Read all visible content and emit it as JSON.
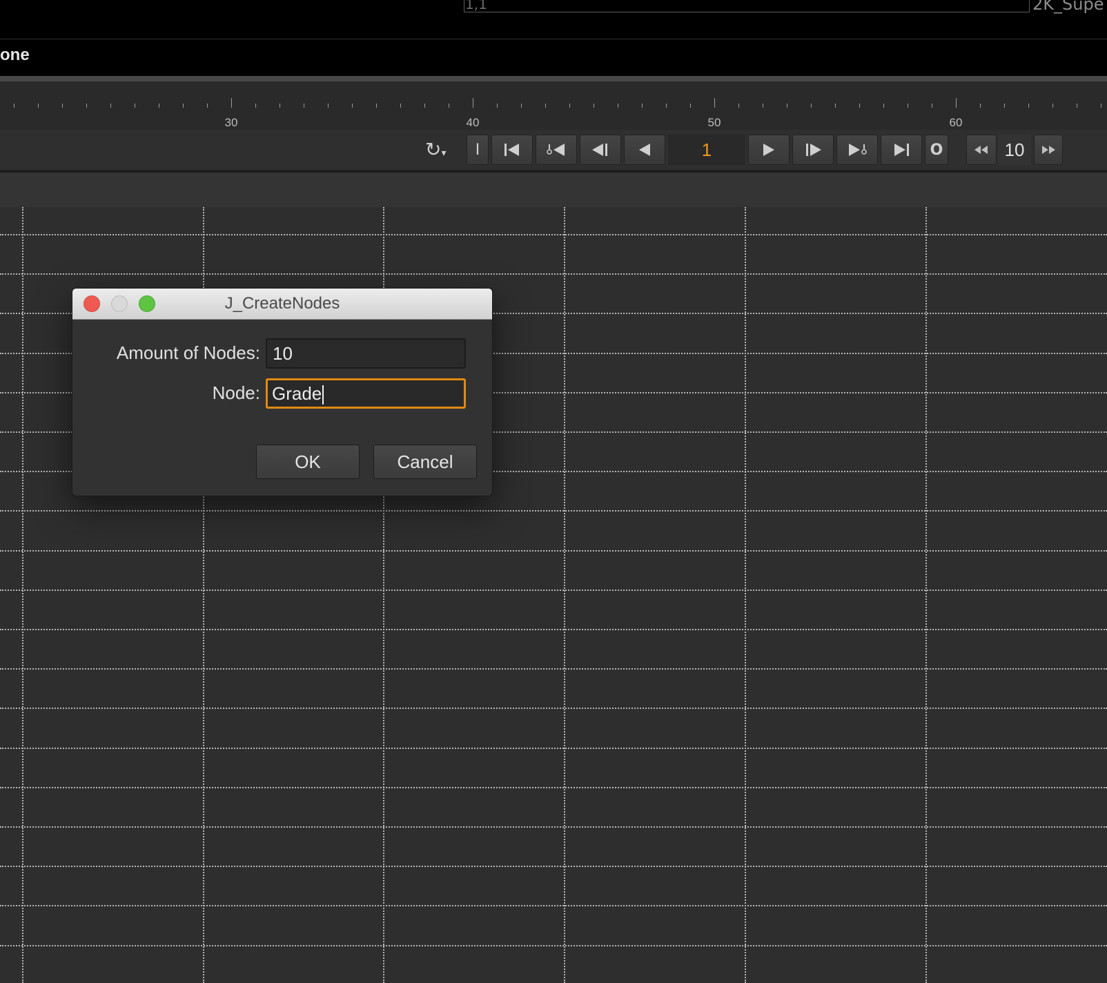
{
  "viewer": {
    "coord_label": "1,1",
    "format_label": "2K_Supe"
  },
  "status": {
    "text": "one"
  },
  "timeline": {
    "labels": [
      "30",
      "40",
      "50",
      "60"
    ]
  },
  "transport": {
    "loop_icon": "loop-mode-icon",
    "in_button": "I",
    "out_button": "O",
    "current_frame": "1",
    "step_value": "10",
    "icons": [
      "first-frame-icon",
      "prev-keyframe-icon",
      "prev-frame-icon",
      "play-backward-icon",
      "play-forward-icon",
      "next-frame-icon",
      "next-keyframe-icon",
      "last-frame-icon",
      "step-back-icon",
      "step-forward-icon"
    ],
    "accent_color": "#f29a1e"
  },
  "dialog": {
    "title": "J_CreateNodes",
    "fields": [
      {
        "label": "Amount of Nodes:",
        "value": "10"
      },
      {
        "label": "Node:",
        "value": "Grade"
      }
    ],
    "ok_label": "OK",
    "cancel_label": "Cancel",
    "focus_color": "#e08a12",
    "traffic_lights": {
      "close": "#ee5a52",
      "minimize": "#d9d9d9",
      "maximize": "#5ec442"
    }
  }
}
